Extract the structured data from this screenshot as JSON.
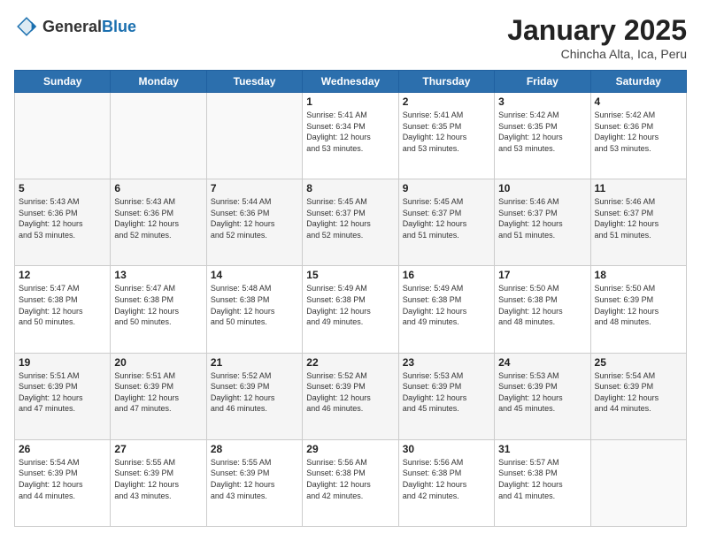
{
  "header": {
    "logo_general": "General",
    "logo_blue": "Blue",
    "month": "January 2025",
    "location": "Chincha Alta, Ica, Peru"
  },
  "days_of_week": [
    "Sunday",
    "Monday",
    "Tuesday",
    "Wednesday",
    "Thursday",
    "Friday",
    "Saturday"
  ],
  "weeks": [
    [
      {
        "day": "",
        "info": ""
      },
      {
        "day": "",
        "info": ""
      },
      {
        "day": "",
        "info": ""
      },
      {
        "day": "1",
        "info": "Sunrise: 5:41 AM\nSunset: 6:34 PM\nDaylight: 12 hours\nand 53 minutes."
      },
      {
        "day": "2",
        "info": "Sunrise: 5:41 AM\nSunset: 6:35 PM\nDaylight: 12 hours\nand 53 minutes."
      },
      {
        "day": "3",
        "info": "Sunrise: 5:42 AM\nSunset: 6:35 PM\nDaylight: 12 hours\nand 53 minutes."
      },
      {
        "day": "4",
        "info": "Sunrise: 5:42 AM\nSunset: 6:36 PM\nDaylight: 12 hours\nand 53 minutes."
      }
    ],
    [
      {
        "day": "5",
        "info": "Sunrise: 5:43 AM\nSunset: 6:36 PM\nDaylight: 12 hours\nand 53 minutes."
      },
      {
        "day": "6",
        "info": "Sunrise: 5:43 AM\nSunset: 6:36 PM\nDaylight: 12 hours\nand 52 minutes."
      },
      {
        "day": "7",
        "info": "Sunrise: 5:44 AM\nSunset: 6:36 PM\nDaylight: 12 hours\nand 52 minutes."
      },
      {
        "day": "8",
        "info": "Sunrise: 5:45 AM\nSunset: 6:37 PM\nDaylight: 12 hours\nand 52 minutes."
      },
      {
        "day": "9",
        "info": "Sunrise: 5:45 AM\nSunset: 6:37 PM\nDaylight: 12 hours\nand 51 minutes."
      },
      {
        "day": "10",
        "info": "Sunrise: 5:46 AM\nSunset: 6:37 PM\nDaylight: 12 hours\nand 51 minutes."
      },
      {
        "day": "11",
        "info": "Sunrise: 5:46 AM\nSunset: 6:37 PM\nDaylight: 12 hours\nand 51 minutes."
      }
    ],
    [
      {
        "day": "12",
        "info": "Sunrise: 5:47 AM\nSunset: 6:38 PM\nDaylight: 12 hours\nand 50 minutes."
      },
      {
        "day": "13",
        "info": "Sunrise: 5:47 AM\nSunset: 6:38 PM\nDaylight: 12 hours\nand 50 minutes."
      },
      {
        "day": "14",
        "info": "Sunrise: 5:48 AM\nSunset: 6:38 PM\nDaylight: 12 hours\nand 50 minutes."
      },
      {
        "day": "15",
        "info": "Sunrise: 5:49 AM\nSunset: 6:38 PM\nDaylight: 12 hours\nand 49 minutes."
      },
      {
        "day": "16",
        "info": "Sunrise: 5:49 AM\nSunset: 6:38 PM\nDaylight: 12 hours\nand 49 minutes."
      },
      {
        "day": "17",
        "info": "Sunrise: 5:50 AM\nSunset: 6:38 PM\nDaylight: 12 hours\nand 48 minutes."
      },
      {
        "day": "18",
        "info": "Sunrise: 5:50 AM\nSunset: 6:39 PM\nDaylight: 12 hours\nand 48 minutes."
      }
    ],
    [
      {
        "day": "19",
        "info": "Sunrise: 5:51 AM\nSunset: 6:39 PM\nDaylight: 12 hours\nand 47 minutes."
      },
      {
        "day": "20",
        "info": "Sunrise: 5:51 AM\nSunset: 6:39 PM\nDaylight: 12 hours\nand 47 minutes."
      },
      {
        "day": "21",
        "info": "Sunrise: 5:52 AM\nSunset: 6:39 PM\nDaylight: 12 hours\nand 46 minutes."
      },
      {
        "day": "22",
        "info": "Sunrise: 5:52 AM\nSunset: 6:39 PM\nDaylight: 12 hours\nand 46 minutes."
      },
      {
        "day": "23",
        "info": "Sunrise: 5:53 AM\nSunset: 6:39 PM\nDaylight: 12 hours\nand 45 minutes."
      },
      {
        "day": "24",
        "info": "Sunrise: 5:53 AM\nSunset: 6:39 PM\nDaylight: 12 hours\nand 45 minutes."
      },
      {
        "day": "25",
        "info": "Sunrise: 5:54 AM\nSunset: 6:39 PM\nDaylight: 12 hours\nand 44 minutes."
      }
    ],
    [
      {
        "day": "26",
        "info": "Sunrise: 5:54 AM\nSunset: 6:39 PM\nDaylight: 12 hours\nand 44 minutes."
      },
      {
        "day": "27",
        "info": "Sunrise: 5:55 AM\nSunset: 6:39 PM\nDaylight: 12 hours\nand 43 minutes."
      },
      {
        "day": "28",
        "info": "Sunrise: 5:55 AM\nSunset: 6:39 PM\nDaylight: 12 hours\nand 43 minutes."
      },
      {
        "day": "29",
        "info": "Sunrise: 5:56 AM\nSunset: 6:38 PM\nDaylight: 12 hours\nand 42 minutes."
      },
      {
        "day": "30",
        "info": "Sunrise: 5:56 AM\nSunset: 6:38 PM\nDaylight: 12 hours\nand 42 minutes."
      },
      {
        "day": "31",
        "info": "Sunrise: 5:57 AM\nSunset: 6:38 PM\nDaylight: 12 hours\nand 41 minutes."
      },
      {
        "day": "",
        "info": ""
      }
    ]
  ]
}
